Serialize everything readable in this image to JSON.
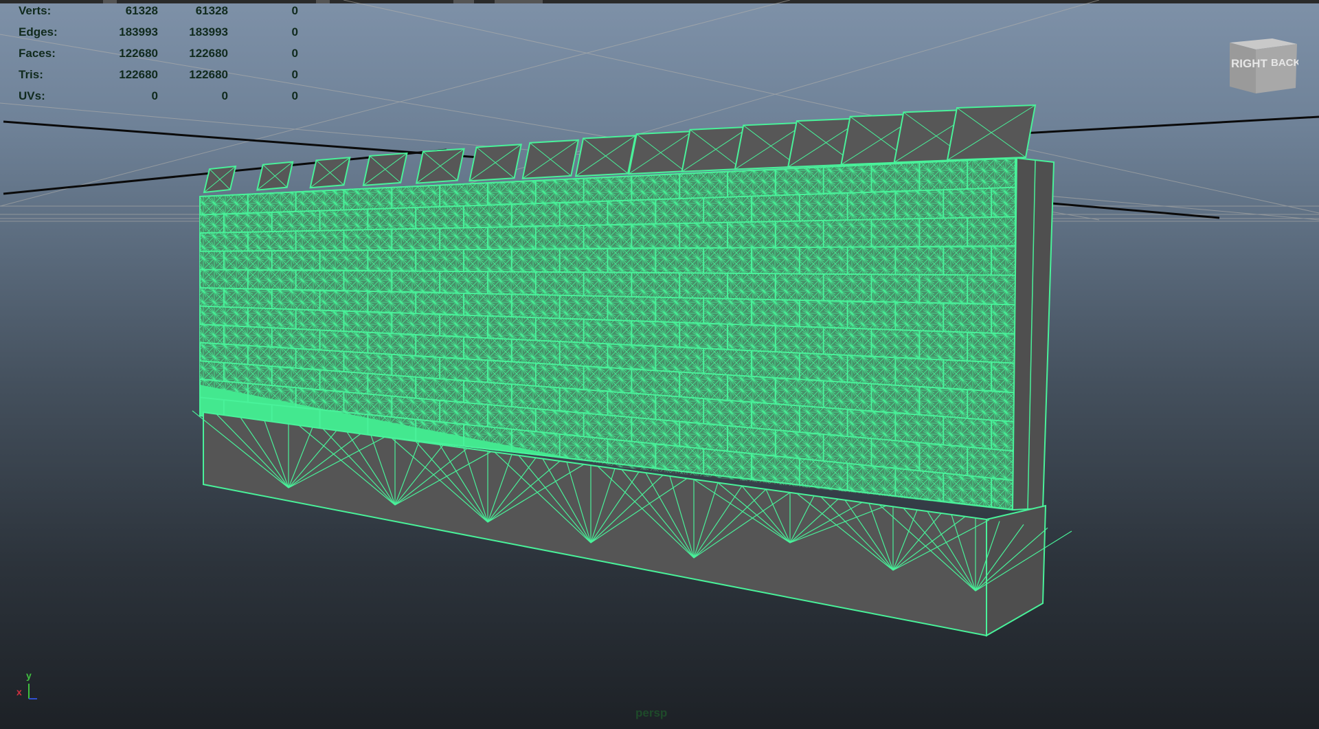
{
  "heads_up_display": {
    "rows": [
      {
        "label": "Verts:",
        "values": [
          "61328",
          "61328",
          "0"
        ]
      },
      {
        "label": "Edges:",
        "values": [
          "183993",
          "183993",
          "0"
        ]
      },
      {
        "label": "Faces:",
        "values": [
          "122680",
          "122680",
          "0"
        ]
      },
      {
        "label": "Tris:",
        "values": [
          "122680",
          "122680",
          "0"
        ]
      },
      {
        "label": "UVs:",
        "values": [
          "0",
          "0",
          "0"
        ]
      }
    ]
  },
  "view_cube": {
    "right_label": "RIGHT",
    "back_label": "BACK"
  },
  "axis_indicator": {
    "y_label": "y",
    "x_label": "x"
  },
  "camera": {
    "name": "persp"
  },
  "colors": {
    "wireframe": "#49f29a",
    "mesh_face": "#575757",
    "hud_text": "#102a1d",
    "viewport_top": "#7e91a8",
    "viewport_bottom": "#1d2126"
  }
}
